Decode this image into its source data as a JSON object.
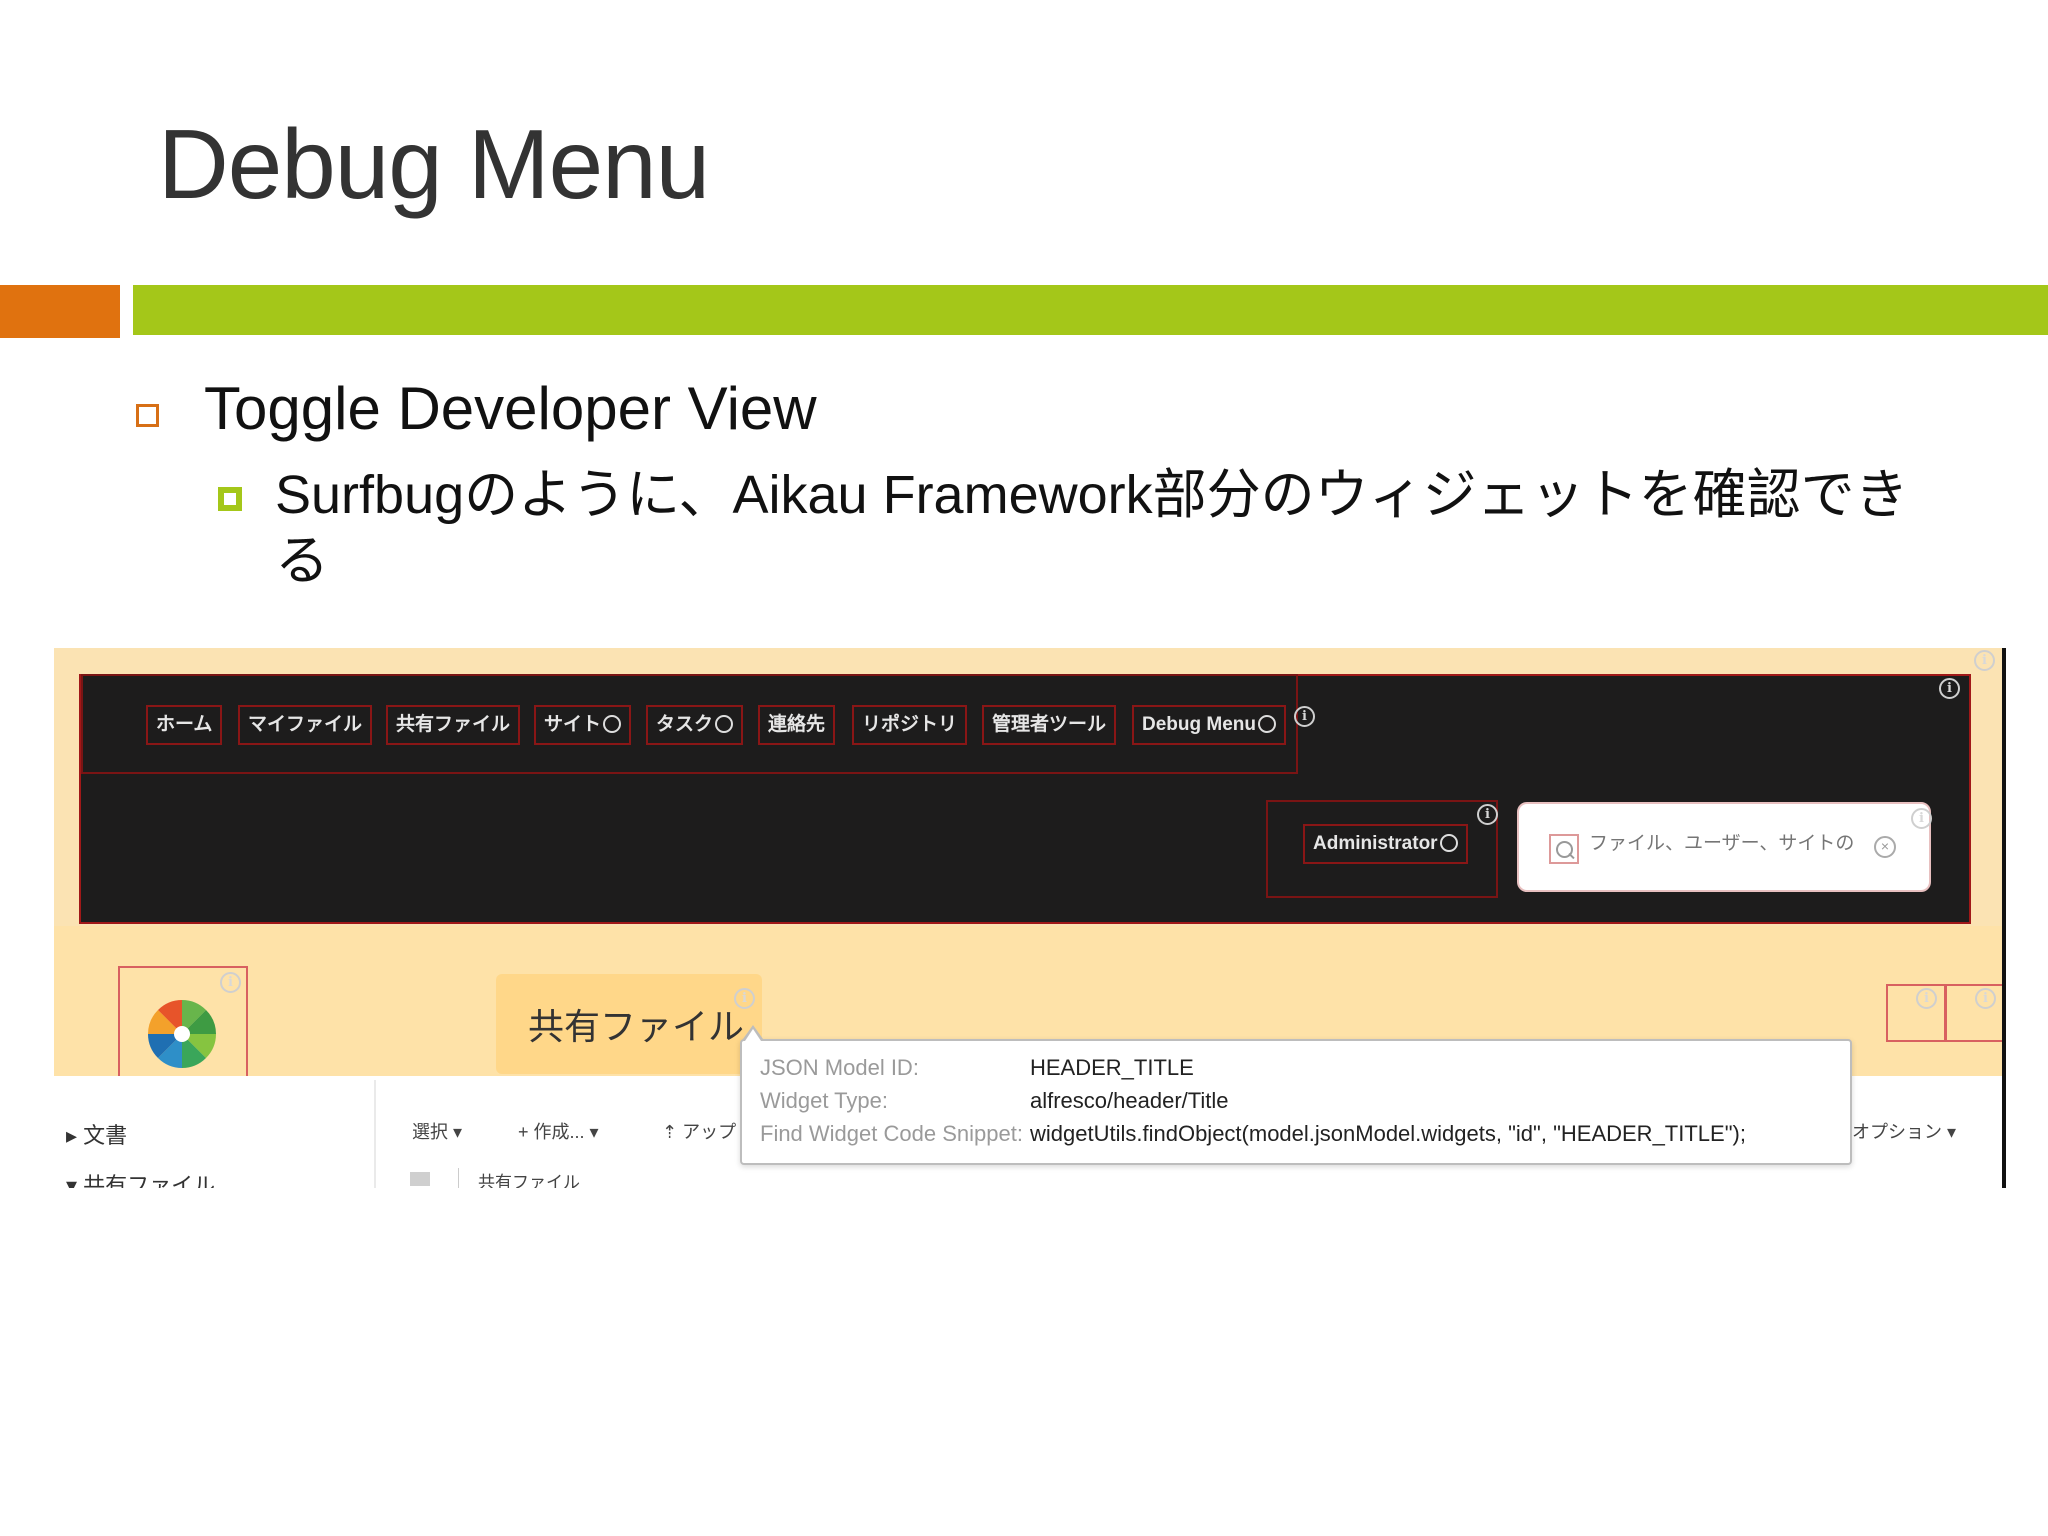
{
  "slide": {
    "title": "Debug Menu",
    "bullet1": "Toggle Developer View",
    "bullet2": "Surfbugのように、Aikau Framework部分のウィジェットを確認できる"
  },
  "colors": {
    "accent_orange": "#E0720F",
    "accent_green": "#A4C719",
    "header_bg": "#1d1c1c",
    "band_bg": "#FEE2A8"
  },
  "header": {
    "menu": [
      {
        "label": "ホーム"
      },
      {
        "label": "マイファイル"
      },
      {
        "label": "共有ファイル"
      },
      {
        "label": "サイト"
      },
      {
        "label": "タスク"
      },
      {
        "label": "連絡先"
      },
      {
        "label": "リポジトリ"
      },
      {
        "label": "管理者ツール"
      },
      {
        "label": "Debug Menu"
      }
    ],
    "user_menu": "Administrator",
    "search_placeholder": "ファイル、ユーザー、サイトの"
  },
  "page": {
    "title": "共有ファイル"
  },
  "sidebar": {
    "items": [
      "文書",
      "共有ファイル"
    ]
  },
  "toolbar": {
    "select": "選択",
    "create": "作成...",
    "upload": "アップ",
    "options": "オプション"
  },
  "breadcrumb": {
    "current": "共有ファイル"
  },
  "tooltip": {
    "rows": [
      {
        "label": "JSON Model ID:",
        "value": "HEADER_TITLE"
      },
      {
        "label": "Widget Type:",
        "value": "alfresco/header/Title"
      },
      {
        "label": "Find Widget Code Snippet:",
        "value": "widgetUtils.findObject(model.jsonModel.widgets, \"id\", \"HEADER_TITLE\");"
      }
    ]
  },
  "icons": {
    "info": "info-icon",
    "search": "search-icon",
    "clear": "clear-icon",
    "logo": "alfresco-logo"
  }
}
